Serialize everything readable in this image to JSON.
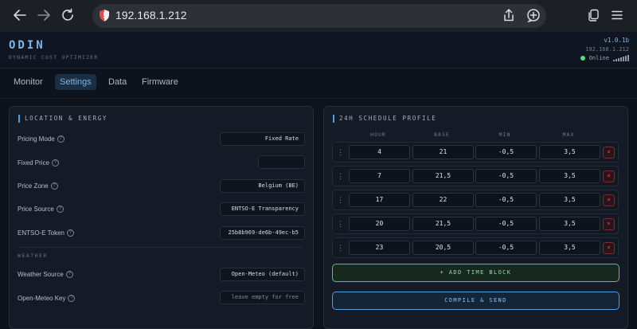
{
  "browser": {
    "url": "192.168.1.212"
  },
  "header": {
    "logo": "ODIN",
    "tagline": "DYNAMIC COST OPTIMIZER",
    "version": "v1.0.1b",
    "ip": "192.168.1.212",
    "status": "Online",
    "status_color": "#4fe07a"
  },
  "tabs": [
    {
      "label": "Monitor"
    },
    {
      "label": "Settings"
    },
    {
      "label": "Data"
    },
    {
      "label": "Firmware"
    }
  ],
  "active_tab": "Settings",
  "location_panel": {
    "title": "LOCATION & ENERGY",
    "pricing_mode": {
      "label": "Pricing Mode",
      "value": "Fixed Rate"
    },
    "fixed_price": {
      "label": "Fixed Price",
      "value": ""
    },
    "price_zone": {
      "label": "Price Zone",
      "value": "Belgium (BE)"
    },
    "price_source": {
      "label": "Price Source",
      "value": "ENTSO-E Transparency"
    },
    "entsoe_token": {
      "label": "ENTSO-E Token",
      "value": "25b8b969-de6b-49ec-b5"
    },
    "weather_section": "WEATHER",
    "weather_source": {
      "label": "Weather Source",
      "value": "Open-Meteo (default)"
    },
    "openmeteo_key": {
      "label": "Open-Meteo Key",
      "placeholder": "leave empty for free"
    }
  },
  "schedule_panel": {
    "title": "24H SCHEDULE PROFILE",
    "columns": [
      "HOUR",
      "BASE",
      "MIN",
      "MAX"
    ],
    "rows": [
      {
        "hour": "4",
        "base": "21",
        "min": "-0,5",
        "max": "3,5"
      },
      {
        "hour": "7",
        "base": "21,5",
        "min": "-0,5",
        "max": "3,5"
      },
      {
        "hour": "17",
        "base": "22",
        "min": "-0,5",
        "max": "3,5"
      },
      {
        "hour": "20",
        "base": "21,5",
        "min": "-0,5",
        "max": "3,5"
      },
      {
        "hour": "23",
        "base": "20,5",
        "min": "-0,5",
        "max": "3,5"
      }
    ],
    "delete_glyph": "×",
    "add_label": "+ ADD TIME BLOCK",
    "send_label": "COMPILE & SEND"
  },
  "colors": {
    "accent": "#4f9ee0",
    "add_button": "#5fbf72",
    "delete": "#e0606d",
    "background": "#0d131c"
  }
}
